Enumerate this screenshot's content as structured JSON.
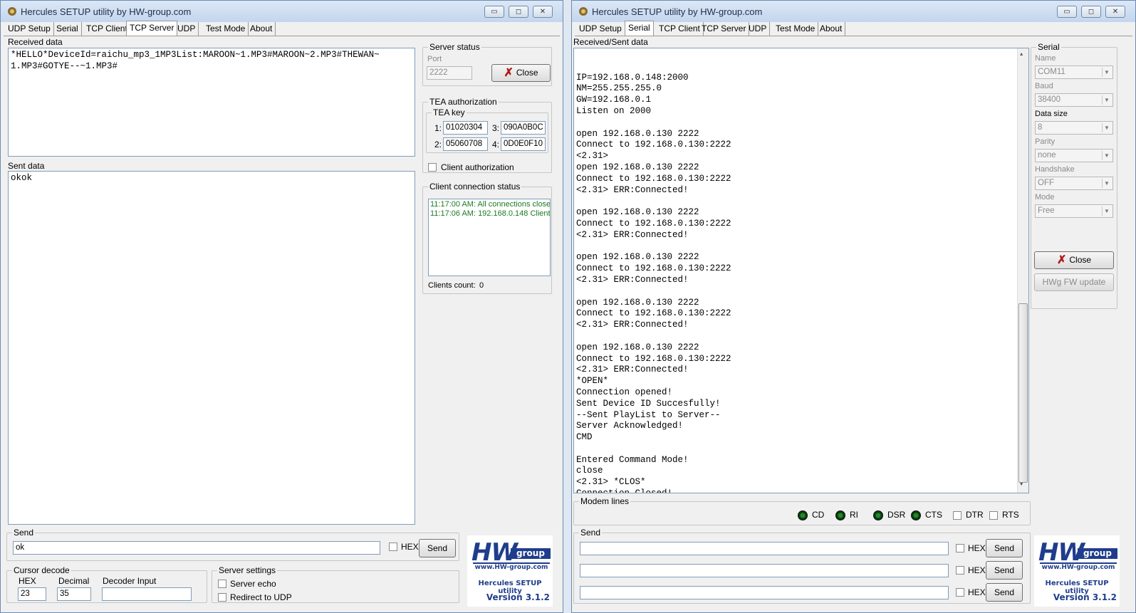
{
  "window_title": "Hercules SETUP utility by HW-group.com",
  "caption_buttons": {
    "minimize": "▭",
    "maximize": "◻",
    "close": "✕"
  },
  "tabs": [
    "UDP Setup",
    "Serial",
    "TCP Client",
    "TCP Server",
    "UDP",
    "Test Mode",
    "About"
  ],
  "left": {
    "active_tab": "TCP Server",
    "received_label": "Received data",
    "received_text": "*HELLO*DeviceId=raichu_mp3_1MP3List:MAROON~1.MP3#MAROON~2.MP3#THEWAN~\n1.MP3#GOTYE--~1.MP3#",
    "sent_label": "Sent data",
    "sent_text": "okok",
    "server_status": {
      "title": "Server status",
      "port_label": "Port",
      "port_value": "2222",
      "close_button": "Close"
    },
    "tea": {
      "title": "TEA authorization",
      "key_title": "TEA key",
      "k1_label": "1:",
      "k1": "01020304",
      "k2_label": "2:",
      "k2": "05060708",
      "k3_label": "3:",
      "k3": "090A0B0C",
      "k4_label": "4:",
      "k4": "0D0E0F10",
      "client_auth": "Client authorization"
    },
    "client_status": {
      "title": "Client connection status",
      "line1": "11:17:00 AM:  All connections close",
      "line2": "11:17:06 AM:  192.168.0.148 Client",
      "count_label": "Clients count:",
      "count_value": "0"
    },
    "send": {
      "title": "Send",
      "value": "ok",
      "hex_label": "HEX",
      "button": "Send"
    },
    "cursor_decode": {
      "title": "Cursor decode",
      "hex_label": "HEX",
      "hex_value": "23",
      "dec_label": "Decimal",
      "dec_value": "35",
      "input_label": "Decoder Input",
      "input_value": ""
    },
    "server_settings": {
      "title": "Server settings",
      "echo": "Server echo",
      "redirect": "Redirect to UDP"
    }
  },
  "right": {
    "active_tab": "Serial",
    "received_label": "Received/Sent data",
    "received_text": "IP=192.168.0.148:2000\nNM=255.255.255.0\nGW=192.168.0.1\nListen on 2000\n\nopen 192.168.0.130 2222\nConnect to 192.168.0.130:2222\n<2.31>\nopen 192.168.0.130 2222\nConnect to 192.168.0.130:2222\n<2.31> ERR:Connected!\n\nopen 192.168.0.130 2222\nConnect to 192.168.0.130:2222\n<2.31> ERR:Connected!\n\nopen 192.168.0.130 2222\nConnect to 192.168.0.130:2222\n<2.31> ERR:Connected!\n\nopen 192.168.0.130 2222\nConnect to 192.168.0.130:2222\n<2.31> ERR:Connected!\n\nopen 192.168.0.130 2222\nConnect to 192.168.0.130:2222\n<2.31> ERR:Connected!\n*OPEN*\nConnection opened!\nSent Device ID Succesfully!\n--Sent PlayList to Server--\nServer Acknowledged!\nCMD\n\nEntered Command Mode!\nclose\n<2.31> *CLOS*\nConnection Closed!",
    "serial": {
      "title": "Serial",
      "name_label": "Name",
      "name_value": "COM11",
      "baud_label": "Baud",
      "baud_value": "38400",
      "datasize_label": "Data size",
      "datasize_value": "8",
      "parity_label": "Parity",
      "parity_value": "none",
      "handshake_label": "Handshake",
      "handshake_value": "OFF",
      "mode_label": "Mode",
      "mode_value": "Free",
      "close_button": "Close",
      "fw_button": "HWg FW update"
    },
    "modem": {
      "title": "Modem lines",
      "cd": "CD",
      "ri": "RI",
      "dsr": "DSR",
      "cts": "CTS",
      "dtr": "DTR",
      "rts": "RTS"
    },
    "send": {
      "title": "Send",
      "hex_label": "HEX",
      "button": "Send",
      "value1": "",
      "value2": "",
      "value3": ""
    }
  },
  "logo": {
    "brand": "HW",
    "group_word": "group",
    "url": "www.HW-group.com",
    "product": "Hercules SETUP utility",
    "version": "Version  3.1.2"
  },
  "colors": {
    "accent_blue": "#1f3d8c",
    "status_green": "#1c7a22",
    "close_red": "#b01818"
  }
}
